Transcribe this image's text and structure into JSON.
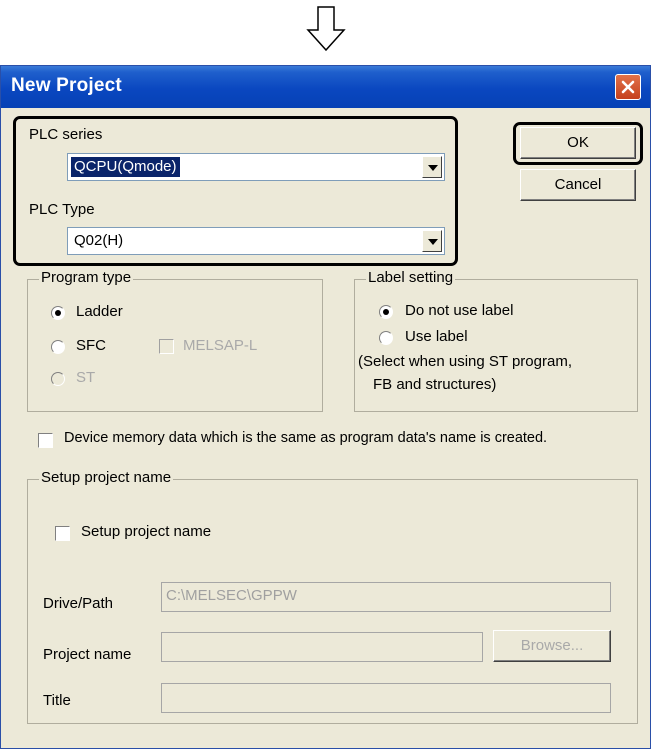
{
  "dialog": {
    "title": "New Project"
  },
  "plc": {
    "series_label": "PLC series",
    "series_value": "QCPU(Qmode)",
    "type_label": "PLC Type",
    "type_value": "Q02(H)"
  },
  "buttons": {
    "ok": "OK",
    "cancel": "Cancel",
    "browse": "Browse..."
  },
  "program_type": {
    "label": "Program type",
    "ladder": "Ladder",
    "sfc": "SFC",
    "melsap": "MELSAP-L",
    "st": "ST"
  },
  "label_setting": {
    "label": "Label setting",
    "no_label": "Do not use label",
    "use_label": "Use label",
    "note_line1": "(Select when using ST program,",
    "note_line2": "FB and structures)"
  },
  "device_memory": {
    "label": "Device memory data which is the same as program data's name is created."
  },
  "setup": {
    "group_label": "Setup project name",
    "checkbox_label": "Setup project name",
    "drive_label": "Drive/Path",
    "drive_value": "C:\\MELSEC\\GPPW",
    "project_label": "Project name",
    "project_value": "",
    "title_label": "Title",
    "title_value": ""
  }
}
